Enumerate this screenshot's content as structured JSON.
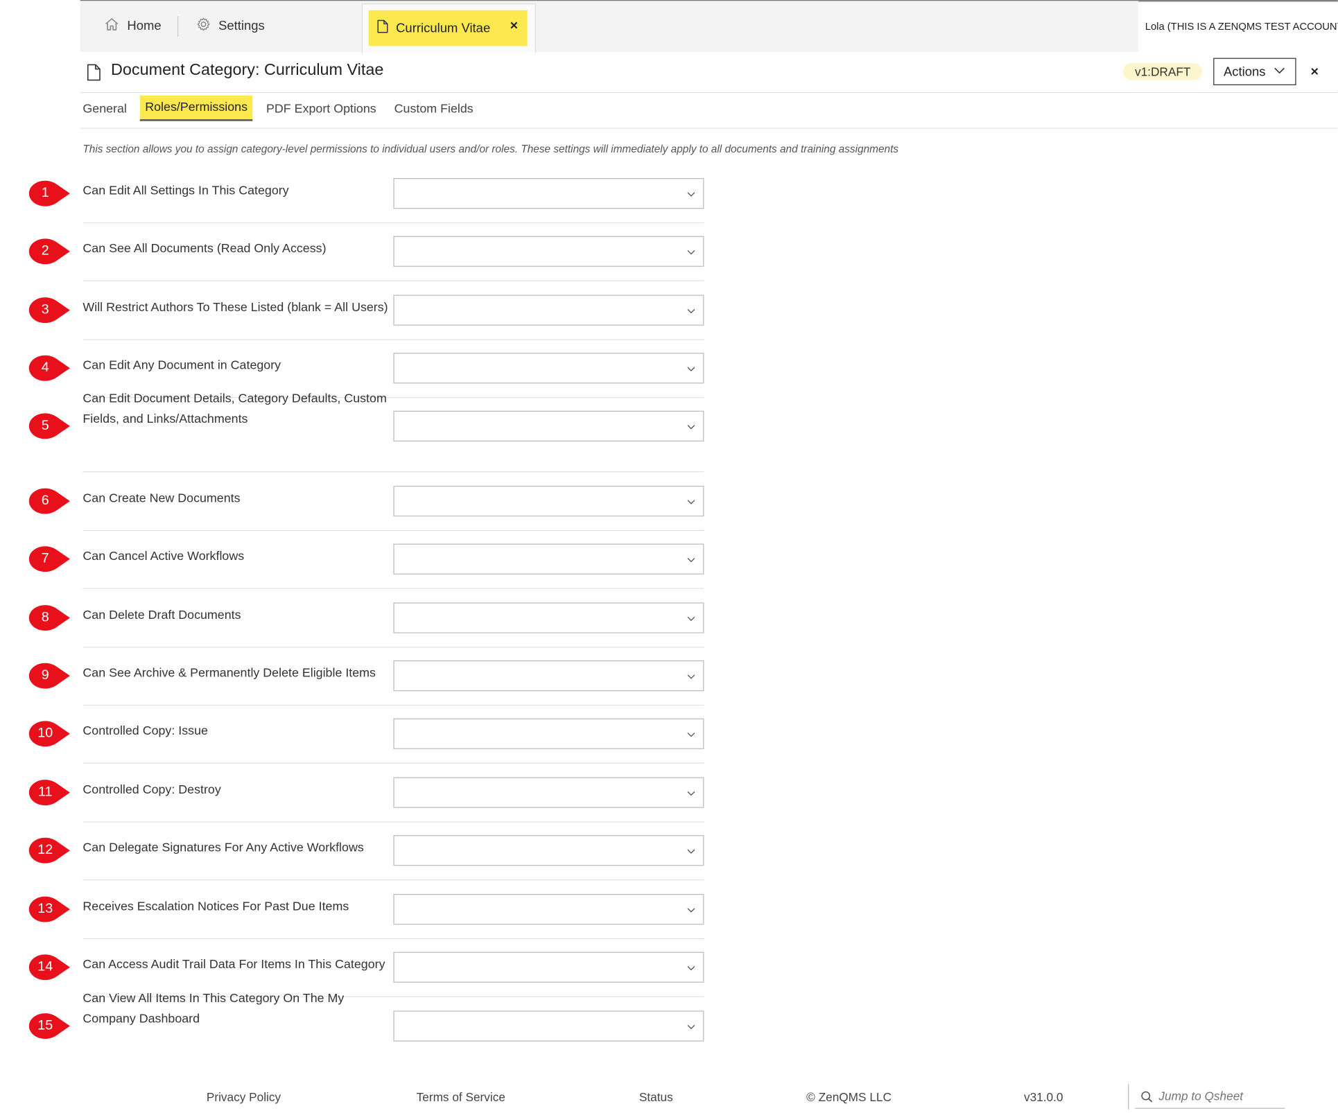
{
  "tabs": {
    "home_label": "Home",
    "settings_label": "Settings",
    "active_label": "Curriculum Vitae",
    "active_close": "×"
  },
  "user": {
    "name": "Lola (THIS IS A ZENQMS TEST ACCOUNT)"
  },
  "header": {
    "title": "Document Category: Curriculum Vitae",
    "version_badge": "v1:DRAFT",
    "actions_label": "Actions",
    "close": "×"
  },
  "subtabs": [
    "General",
    "Roles/Permissions",
    "PDF Export Options",
    "Custom Fields"
  ],
  "active_subtab": "Roles/Permissions",
  "description": "This section allows you to assign category-level permissions to individual users and/or roles. These settings will immediately apply to all documents and training assignments",
  "permissions": [
    {
      "num": "1",
      "label": "Can Edit All Settings In This Category",
      "value": ""
    },
    {
      "num": "2",
      "label": "Can See All Documents (Read Only Access)",
      "value": ""
    },
    {
      "num": "3",
      "label": "Will Restrict Authors To These Listed (blank = All Users)",
      "value": ""
    },
    {
      "num": "4",
      "label": "Can Edit Any Document in Category",
      "value": ""
    },
    {
      "num": "5",
      "label": "Can Edit Document Details, Category Defaults, Custom Fields, and Links/Attachments",
      "value": ""
    },
    {
      "num": "6",
      "label": "Can Create New Documents",
      "value": ""
    },
    {
      "num": "7",
      "label": "Can Cancel Active Workflows",
      "value": ""
    },
    {
      "num": "8",
      "label": "Can Delete Draft Documents",
      "value": ""
    },
    {
      "num": "9",
      "label": "Can See Archive & Permanently Delete Eligible Items",
      "value": ""
    },
    {
      "num": "10",
      "label": "Controlled Copy: Issue",
      "value": ""
    },
    {
      "num": "11",
      "label": "Controlled Copy: Destroy",
      "value": ""
    },
    {
      "num": "12",
      "label": "Can Delegate Signatures For Any Active Workflows",
      "value": ""
    },
    {
      "num": "13",
      "label": "Receives Escalation Notices For Past Due Items",
      "value": ""
    },
    {
      "num": "14",
      "label": "Can Access Audit Trail Data For Items In This Category",
      "value": ""
    },
    {
      "num": "15",
      "label": "Can View All Items In This Category On The My Company Dashboard",
      "value": ""
    }
  ],
  "footer": {
    "privacy": "Privacy Policy",
    "terms": "Terms of Service",
    "status": "Status",
    "copyright": "© ZenQMS LLC",
    "version": "v31.0.0",
    "search_placeholder": "Jump to Qsheet"
  },
  "colors": {
    "highlight": "#fce94f",
    "marker": "#e8101a",
    "badge_bg": "#fdf6cc"
  },
  "icons": {
    "home": "home-icon",
    "settings": "gear-icon",
    "document": "document-icon",
    "chevron": "chevron-down-icon",
    "search": "search-icon"
  }
}
